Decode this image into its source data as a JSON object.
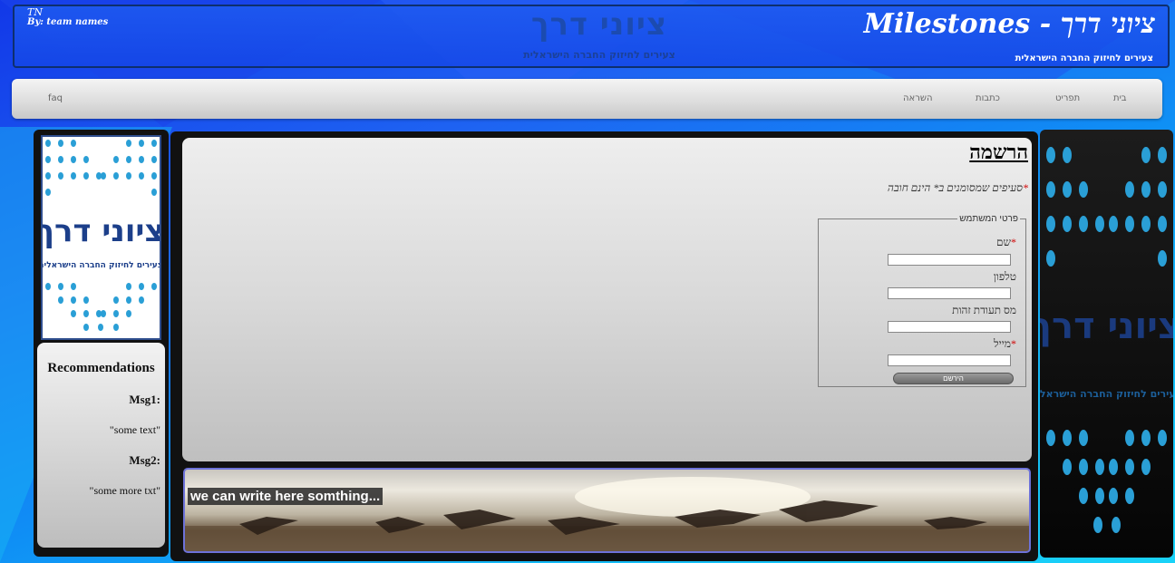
{
  "header": {
    "tn": "TN",
    "by": "By: team names",
    "logo_main": "ציוני דרך",
    "logo_sub": "צעירים לחיזוק החברה הישראלית",
    "title": "ציוני דרך - Milestones",
    "subtitle": "צעירים לחיזוק החברה הישראלית"
  },
  "nav": {
    "items": [
      "בית",
      "תפריט",
      "כתבות",
      "השראה"
    ],
    "faq": "faq"
  },
  "sidebar_left": {
    "logo_text": "ציוני דרך",
    "logo_sub": "צעירים לחיזוק החברה הישראלית",
    "recommendations_title": "Recommendations",
    "messages": [
      {
        "label": "Msg1:",
        "text": "\"some text\""
      },
      {
        "label": "Msg2:",
        "text": "\"some more txt\""
      }
    ]
  },
  "main": {
    "page_title": "הרשמה",
    "required_note": "סעיפים שמסומנים ב* הינם חובה",
    "required_star": "*",
    "fieldset_legend": "פרטי המשתמש",
    "fields": [
      {
        "label": "שם",
        "required": "*",
        "value": ""
      },
      {
        "label": "טלפון",
        "required": "",
        "value": ""
      },
      {
        "label": "מס תעודת זהות",
        "required": "",
        "value": ""
      },
      {
        "label": "מייל",
        "required": "*",
        "value": ""
      }
    ],
    "submit_label": "הירשם",
    "banner_caption": "we can write here somthing..."
  },
  "sidebar_right": {
    "logo_text": "ציוני דרך",
    "logo_sub": "צעירים לחיזוק החברה הישראלית"
  },
  "colors": {
    "accent_blue": "#1e63f2",
    "dot_blue": "#2a9fd6",
    "logo_navy": "#1c3f8a",
    "required_red": "#d00000"
  }
}
